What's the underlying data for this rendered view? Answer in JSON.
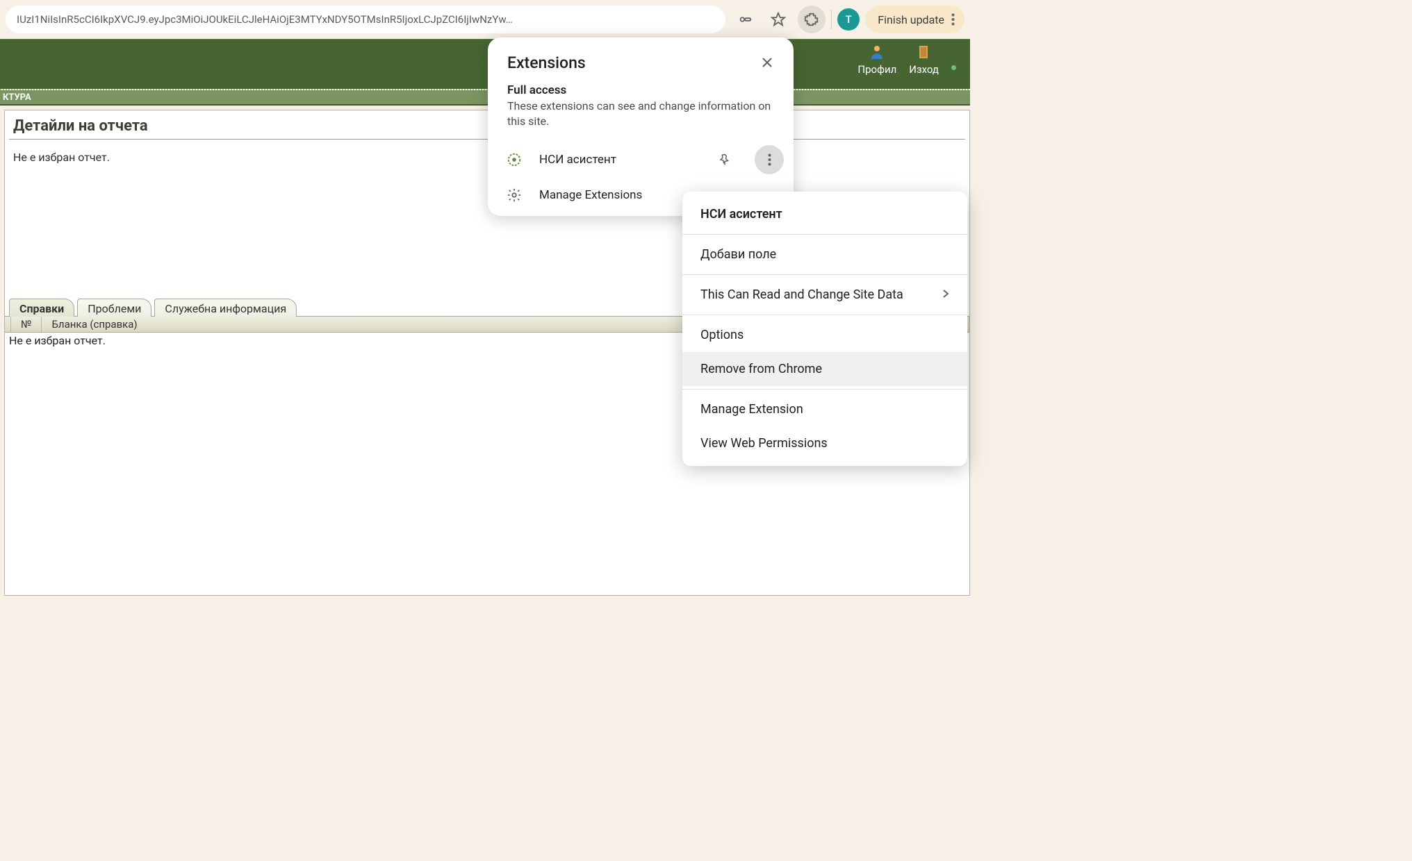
{
  "address_bar": {
    "url_text": "IUzI1NiIsInR5cCI6IkpXVCJ9.eyJpc3MiOiJOUkEiLCJleHAiOjE3MTYxNDY5OTMsInR5IjoxLCJpZCI6IjIwNzYw…"
  },
  "chrome_actions": {
    "avatar_letter": "T",
    "finish_update_label": "Finish update"
  },
  "app_header": {
    "nav_label": "КТУРА",
    "links": {
      "profile": "Профил",
      "exit": "Изход"
    }
  },
  "details": {
    "title": "Детайли на отчета",
    "no_report_msg": "Не е избран отчет."
  },
  "tabs": {
    "items": [
      {
        "label": "Справки",
        "active": true
      },
      {
        "label": "Проблеми",
        "active": false
      },
      {
        "label": "Служебна информация",
        "active": false
      }
    ],
    "columns": {
      "no": "№",
      "blank": "Бланка (справка)"
    },
    "table_msg": "Не е избран отчет."
  },
  "extensions_popup": {
    "title": "Extensions",
    "section_label": "Full access",
    "section_desc": "These extensions can see and change information on this site.",
    "item_name": "НСИ асистент",
    "manage_label": "Manage Extensions"
  },
  "context_menu": {
    "title": "НСИ асистент",
    "items": {
      "add_field": "Добави поле",
      "site_data": "This Can Read and Change Site Data",
      "options": "Options",
      "remove": "Remove from Chrome",
      "manage": "Manage Extension",
      "view_perms": "View Web Permissions"
    }
  }
}
